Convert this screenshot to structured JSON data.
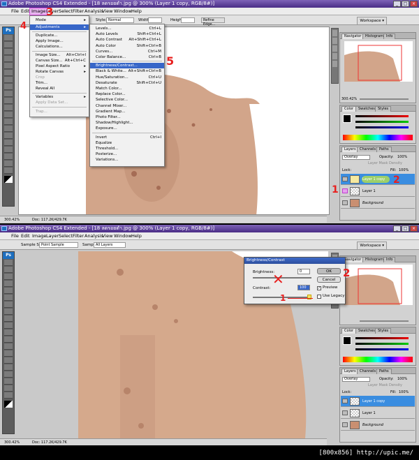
{
  "app": {
    "top_title": "Adobe Photoshop CS4 Extended - [18 ลดรอยดำ.jpg @ 300% (Layer 1 copy, RGB/8#)]",
    "bottom_title": "Adobe Photoshop CS4 Extended - [18 ลดรอยดำ.jpg @ 300% (Layer 1 copy, RGB/8#)]"
  },
  "menu": {
    "file": "File",
    "edit": "Edit",
    "image": "Image",
    "layer": "Layer",
    "select": "Select",
    "filter": "Filter",
    "analysis": "Analysis",
    "view": "View",
    "window": "Window",
    "help": "Help"
  },
  "options_top": {
    "style_label": "Style:",
    "style_value": "Normal",
    "width_label": "Width:",
    "height_label": "Height:",
    "refine_edge": "Refine Edge...",
    "workspace": "Workspace ▾"
  },
  "options_bottom": {
    "sample_size_label": "Sample Size:",
    "sample_size_value": "Point Sample",
    "sample_label": "Sample:",
    "sample_value": "All Layers",
    "workspace": "Workspace ▾"
  },
  "image_menu": {
    "mode": "Mode",
    "adjustments": "Adjustments",
    "duplicate": "Duplicate...",
    "apply_image": "Apply Image...",
    "calculations": "Calculations...",
    "image_size": "Image Size...",
    "image_size_sc": "Alt+Ctrl+I",
    "canvas_size": "Canvas Size...",
    "canvas_size_sc": "Alt+Ctrl+C",
    "pixel_aspect": "Pixel Aspect Ratio",
    "rotate_canvas": "Rotate Canvas",
    "crop": "Crop",
    "trim": "Trim...",
    "reveal_all": "Reveal All",
    "variables": "Variables",
    "apply_data_set": "Apply Data Set...",
    "trap": "Trap..."
  },
  "adjust_menu": [
    {
      "label": "Levels...",
      "shortcut": "Ctrl+L"
    },
    {
      "label": "Auto Levels",
      "shortcut": "Shift+Ctrl+L"
    },
    {
      "label": "Auto Contrast",
      "shortcut": "Alt+Shift+Ctrl+L"
    },
    {
      "label": "Auto Color",
      "shortcut": "Shift+Ctrl+B"
    },
    {
      "label": "Curves...",
      "shortcut": "Ctrl+M"
    },
    {
      "label": "Color Balance...",
      "shortcut": "Ctrl+B"
    },
    {
      "label": "Brightness/Contrast...",
      "shortcut": ""
    },
    {
      "label": "Black & White...",
      "shortcut": "Alt+Shift+Ctrl+B"
    },
    {
      "label": "Hue/Saturation...",
      "shortcut": "Ctrl+U"
    },
    {
      "label": "Desaturate",
      "shortcut": "Shift+Ctrl+U"
    },
    {
      "label": "Match Color...",
      "shortcut": ""
    },
    {
      "label": "Replace Color...",
      "shortcut": ""
    },
    {
      "label": "Selective Color...",
      "shortcut": ""
    },
    {
      "label": "Channel Mixer...",
      "shortcut": ""
    },
    {
      "label": "Gradient Map...",
      "shortcut": ""
    },
    {
      "label": "Photo Filter...",
      "shortcut": ""
    },
    {
      "label": "Shadow/Highlight...",
      "shortcut": ""
    },
    {
      "label": "Exposure...",
      "shortcut": ""
    },
    {
      "label": "Invert",
      "shortcut": "Ctrl+I"
    },
    {
      "label": "Equalize",
      "shortcut": ""
    },
    {
      "label": "Threshold...",
      "shortcut": ""
    },
    {
      "label": "Posterize...",
      "shortcut": ""
    },
    {
      "label": "Variations...",
      "shortcut": ""
    }
  ],
  "panels": {
    "navigator": "Navigator",
    "histogram": "Histogram",
    "info": "Info",
    "nav_zoom": "300.42%",
    "color": "Color",
    "swatches": "Swatches",
    "styles": "Styles",
    "layers": "Layers",
    "channels": "Channels",
    "paths": "Paths",
    "blend_mode": "Overlay",
    "opacity_label": "Opacity:",
    "opacity_value": "100%",
    "mask_density": "Layer Mask Density",
    "lock_label": "Lock:",
    "fill_label": "Fill:",
    "fill_value": "100%"
  },
  "layers": [
    {
      "name": "Layer 1 copy"
    },
    {
      "name": "Layer 1"
    },
    {
      "name": "Background"
    }
  ],
  "status": {
    "zoom": "300.42%",
    "doc": "Doc: 117.2K/429.7K"
  },
  "dialog": {
    "title": "Brightness/Contrast",
    "brightness_label": "Brightness:",
    "brightness_value": "0",
    "contrast_label": "Contrast:",
    "contrast_value": "100",
    "ok": "OK",
    "cancel": "Cancel",
    "preview": "Preview",
    "legacy": "Use Legacy"
  },
  "annotations": {
    "a1": "1",
    "a2": "2",
    "a3": "3",
    "a4": "4",
    "a5": "5",
    "b1": "1",
    "b2": "2",
    "cross": "✕"
  },
  "footer": "[800x856] http://upic.me/"
}
